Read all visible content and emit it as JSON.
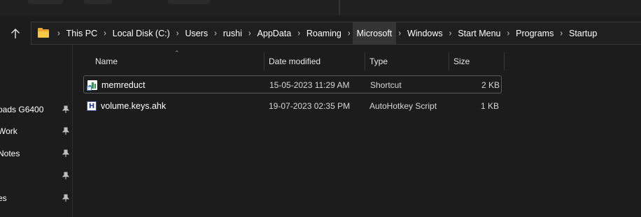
{
  "address": {
    "crumbs": [
      "This PC",
      "Local Disk (C:)",
      "Users",
      "rushi",
      "AppData",
      "Roaming",
      "Microsoft",
      "Windows",
      "Start Menu",
      "Programs",
      "Startup"
    ]
  },
  "sidebar": {
    "items": [
      {
        "label": "oads G6400"
      },
      {
        "label": "Work"
      },
      {
        "label": "Notes"
      },
      {
        "label": ""
      },
      {
        "label": "es"
      }
    ]
  },
  "columns": {
    "name": "Name",
    "date": "Date modified",
    "type": "Type",
    "size": "Size"
  },
  "files": [
    {
      "name": "memreduct",
      "date": "15-05-2023 11:29 AM",
      "type": "Shortcut",
      "size": "2 KB",
      "icon": "shortcut-icon"
    },
    {
      "name": "volume.keys.ahk",
      "date": "19-07-2023 02:35 PM",
      "type": "AutoHotkey Script",
      "size": "1 KB",
      "icon": "autohotkey-icon"
    }
  ],
  "icons": {
    "up": "arrow-up-icon",
    "folder": "folder-icon",
    "pin": "pin-icon",
    "separator": "chevron-right-icon"
  },
  "colors": {
    "background": "#1c1c1c",
    "folder": "#f7c948",
    "text": "#ffffff"
  }
}
